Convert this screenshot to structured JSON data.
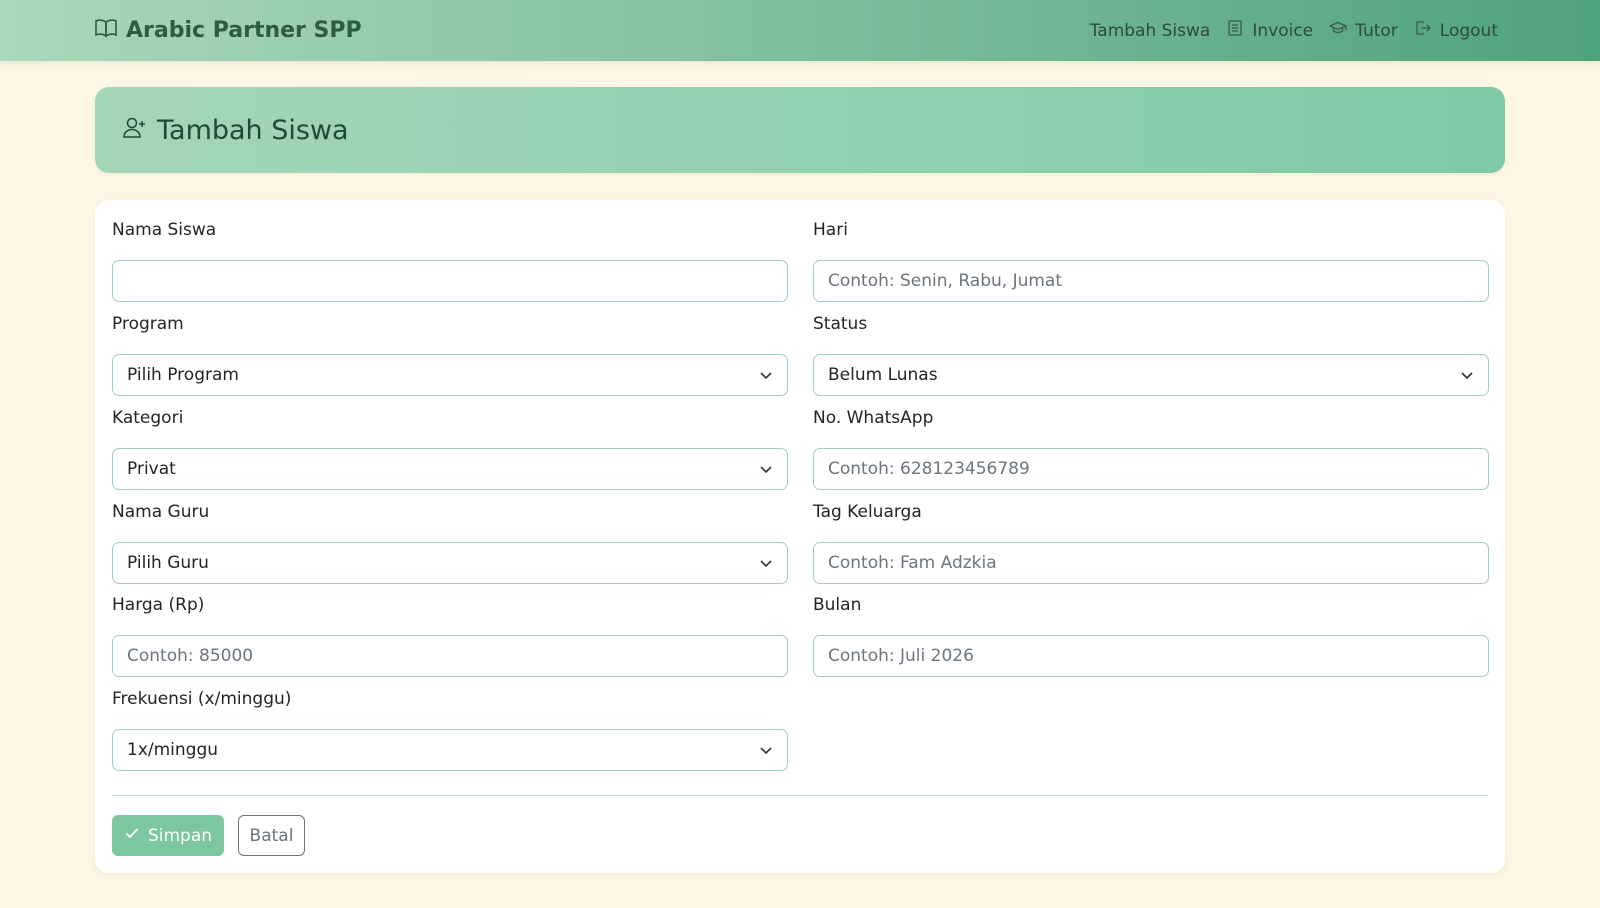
{
  "brand": {
    "name": "Arabic Partner SPP",
    "icon": "book-icon"
  },
  "nav": {
    "items": [
      {
        "label": "Tambah Siswa",
        "icon": ""
      },
      {
        "label": "Invoice",
        "icon": "receipt-icon"
      },
      {
        "label": "Tutor",
        "icon": "graduation-cap-icon"
      },
      {
        "label": "Logout",
        "icon": "logout-icon"
      }
    ]
  },
  "header": {
    "title": "Tambah Siswa",
    "icon": "person-add-icon"
  },
  "form": {
    "left": [
      {
        "label": "Nama Siswa",
        "type": "input",
        "value": "",
        "placeholder": ""
      },
      {
        "label": "Program",
        "type": "select",
        "value": "Pilih Program"
      },
      {
        "label": "Kategori",
        "type": "select",
        "value": "Privat"
      },
      {
        "label": "Nama Guru",
        "type": "select",
        "value": "Pilih Guru"
      },
      {
        "label": "Harga (Rp)",
        "type": "input",
        "value": "",
        "placeholder": "Contoh: 85000"
      },
      {
        "label": "Frekuensi (x/minggu)",
        "type": "select",
        "value": "1x/minggu"
      }
    ],
    "right": [
      {
        "label": "Hari",
        "type": "input",
        "value": "",
        "placeholder": "Contoh: Senin, Rabu, Jumat"
      },
      {
        "label": "Status",
        "type": "select",
        "value": "Belum Lunas"
      },
      {
        "label": "No. WhatsApp",
        "type": "input",
        "value": "",
        "placeholder": "Contoh: 628123456789"
      },
      {
        "label": "Tag Keluarga",
        "type": "input",
        "value": "",
        "placeholder": "Contoh: Fam Adzkia"
      },
      {
        "label": "Bulan",
        "type": "input",
        "value": "",
        "placeholder": "Contoh: Juli 2026"
      }
    ]
  },
  "actions": {
    "save_label": "Simpan",
    "cancel_label": "Batal"
  },
  "colors": {
    "accent": "#7cc7a0",
    "brand_text": "#2e5d3e",
    "background": "#fdf6e3",
    "border": "#9fd2b5"
  }
}
